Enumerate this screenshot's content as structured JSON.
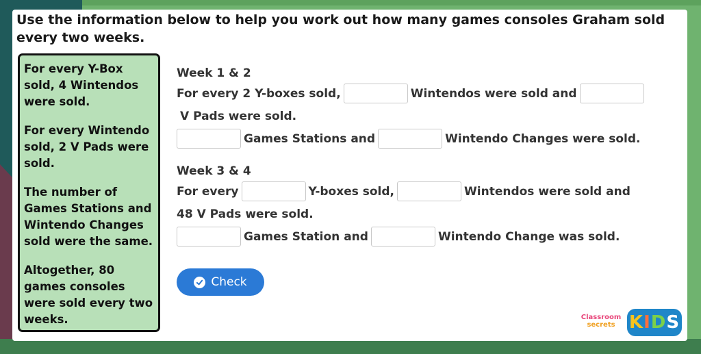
{
  "question": "Use the information below to help you work out how many games consoles Graham sold every two weeks.",
  "info_box": [
    "For every Y-Box sold, 4 Wintendos were sold.",
    "For every Wintendo sold, 2 V Pads were sold.",
    "The number of Games Stations and Wintendo Changes sold were the same.",
    "Altogether, 80 games consoles were sold every two weeks."
  ],
  "week12": {
    "title": "Week 1 & 2",
    "line1_a": "For every 2 Y-boxes sold,",
    "line1_b": "Wintendos were sold and",
    "line2": "V Pads were sold.",
    "line3_a": "Games Stations and",
    "line3_b": "Wintendo Changes were sold."
  },
  "week34": {
    "title": "Week 3 & 4",
    "line1_a": "For every",
    "line1_b": "Y-boxes sold,",
    "line1_c": "Wintendos were sold and",
    "line2": "48 V Pads were sold.",
    "line3_a": "Games Station and",
    "line3_b": "Wintendo Change was sold."
  },
  "inputs": {
    "w12_wintendos": "",
    "w12_vpads": "",
    "w12_games_stations": "",
    "w12_wintendo_changes": "",
    "w34_yboxes": "",
    "w34_wintendos": "",
    "w34_games_station": "",
    "w34_wintendo_change": ""
  },
  "check_button": {
    "label": "Check",
    "icon": "check-circle-icon",
    "color": "#2b7ad6"
  },
  "logo": {
    "line1": "Classroom",
    "line2": "secrets",
    "kids": [
      "K",
      "I",
      "D",
      "S"
    ]
  }
}
